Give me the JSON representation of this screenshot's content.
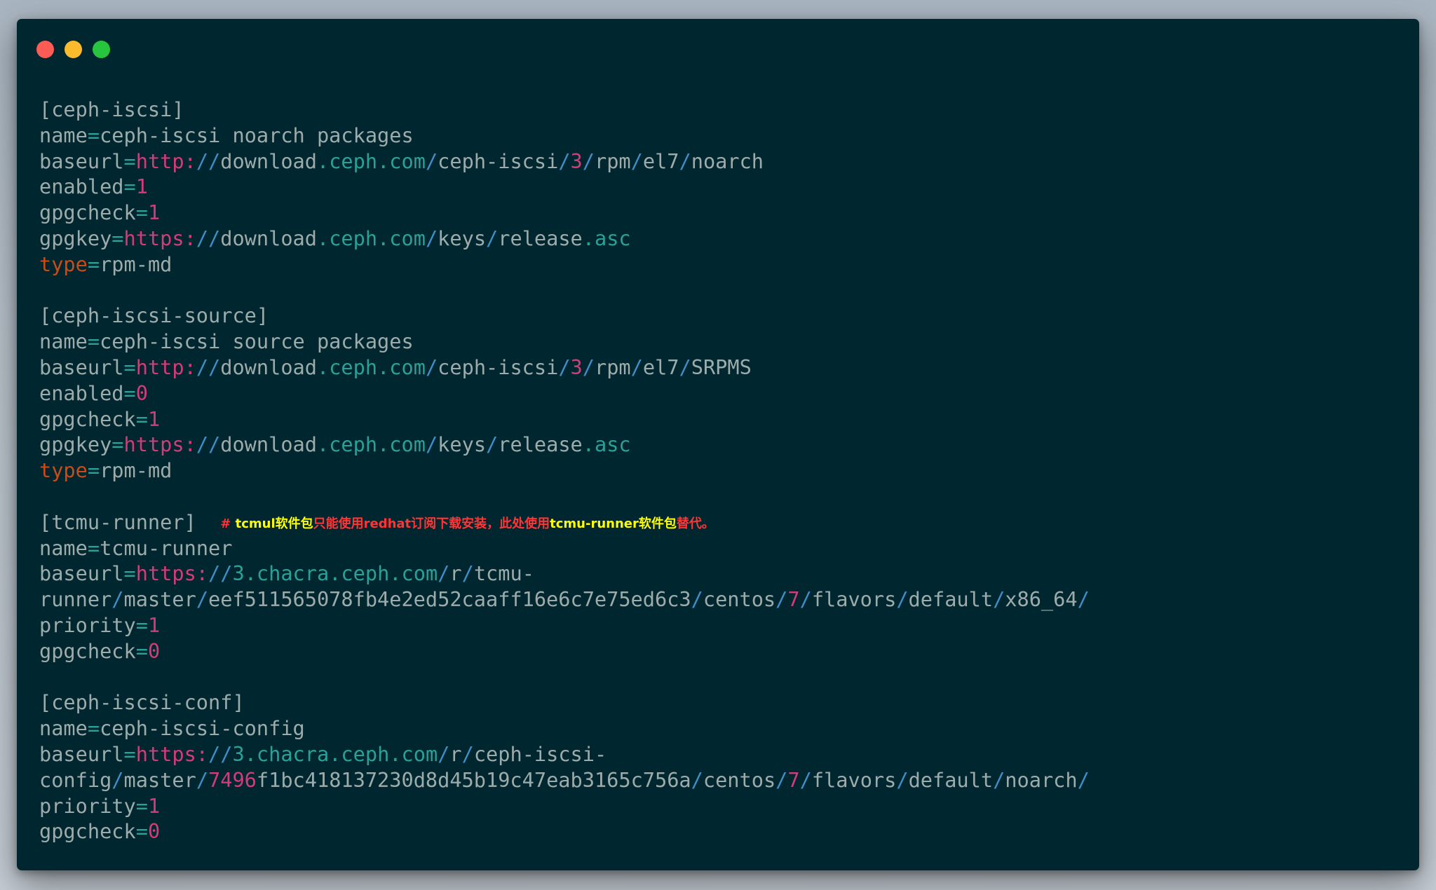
{
  "window": {
    "traffic_lights": [
      {
        "name": "close",
        "color": "#fd5c55"
      },
      {
        "name": "minimize",
        "color": "#fcbb2d"
      },
      {
        "name": "zoom",
        "color": "#28c63f"
      }
    ]
  },
  "theme": {
    "background": "#00272f",
    "text": "#9eabab",
    "pink": "#d33c79",
    "teal": "#2aa198",
    "blue": "#3f8ec7",
    "orange": "#cb4b16",
    "comment_red": "#ff3535",
    "comment_yellow": "#ffff00"
  },
  "code_lines": [
    [
      {
        "t": "[ceph-iscsi]"
      }
    ],
    [
      {
        "t": "name"
      },
      {
        "t": "=",
        "c": "teal"
      },
      {
        "t": "ceph-iscsi noarch packages"
      }
    ],
    [
      {
        "t": "baseurl"
      },
      {
        "t": "=",
        "c": "teal"
      },
      {
        "t": "http:",
        "c": "pink"
      },
      {
        "t": "//",
        "c": "blue"
      },
      {
        "t": "download"
      },
      {
        "t": ".",
        "c": "teal"
      },
      {
        "t": "ceph",
        "c": "teal"
      },
      {
        "t": ".",
        "c": "teal"
      },
      {
        "t": "com",
        "c": "teal"
      },
      {
        "t": "/",
        "c": "blue"
      },
      {
        "t": "ceph-iscsi"
      },
      {
        "t": "/",
        "c": "blue"
      },
      {
        "t": "3",
        "c": "pink"
      },
      {
        "t": "/",
        "c": "blue"
      },
      {
        "t": "rpm"
      },
      {
        "t": "/",
        "c": "blue"
      },
      {
        "t": "el7"
      },
      {
        "t": "/",
        "c": "blue"
      },
      {
        "t": "noarch"
      }
    ],
    [
      {
        "t": "enabled"
      },
      {
        "t": "=",
        "c": "teal"
      },
      {
        "t": "1",
        "c": "pink"
      }
    ],
    [
      {
        "t": "gpgcheck"
      },
      {
        "t": "=",
        "c": "teal"
      },
      {
        "t": "1",
        "c": "pink"
      }
    ],
    [
      {
        "t": "gpgkey"
      },
      {
        "t": "=",
        "c": "teal"
      },
      {
        "t": "https:",
        "c": "pink"
      },
      {
        "t": "//",
        "c": "blue"
      },
      {
        "t": "download"
      },
      {
        "t": ".",
        "c": "teal"
      },
      {
        "t": "ceph",
        "c": "teal"
      },
      {
        "t": ".",
        "c": "teal"
      },
      {
        "t": "com",
        "c": "teal"
      },
      {
        "t": "/",
        "c": "blue"
      },
      {
        "t": "keys"
      },
      {
        "t": "/",
        "c": "blue"
      },
      {
        "t": "release"
      },
      {
        "t": ".",
        "c": "teal"
      },
      {
        "t": "asc",
        "c": "teal"
      }
    ],
    [
      {
        "t": "type",
        "c": "orange"
      },
      {
        "t": "=",
        "c": "teal"
      },
      {
        "t": "rpm-md"
      }
    ],
    [],
    [
      {
        "t": "[ceph-iscsi-source]"
      }
    ],
    [
      {
        "t": "name"
      },
      {
        "t": "=",
        "c": "teal"
      },
      {
        "t": "ceph-iscsi source packages"
      }
    ],
    [
      {
        "t": "baseurl"
      },
      {
        "t": "=",
        "c": "teal"
      },
      {
        "t": "http:",
        "c": "pink"
      },
      {
        "t": "//",
        "c": "blue"
      },
      {
        "t": "download"
      },
      {
        "t": ".",
        "c": "teal"
      },
      {
        "t": "ceph",
        "c": "teal"
      },
      {
        "t": ".",
        "c": "teal"
      },
      {
        "t": "com",
        "c": "teal"
      },
      {
        "t": "/",
        "c": "blue"
      },
      {
        "t": "ceph-iscsi"
      },
      {
        "t": "/",
        "c": "blue"
      },
      {
        "t": "3",
        "c": "pink"
      },
      {
        "t": "/",
        "c": "blue"
      },
      {
        "t": "rpm"
      },
      {
        "t": "/",
        "c": "blue"
      },
      {
        "t": "el7"
      },
      {
        "t": "/",
        "c": "blue"
      },
      {
        "t": "SRPMS"
      }
    ],
    [
      {
        "t": "enabled"
      },
      {
        "t": "=",
        "c": "teal"
      },
      {
        "t": "0",
        "c": "pink"
      }
    ],
    [
      {
        "t": "gpgcheck"
      },
      {
        "t": "=",
        "c": "teal"
      },
      {
        "t": "1",
        "c": "pink"
      }
    ],
    [
      {
        "t": "gpgkey"
      },
      {
        "t": "=",
        "c": "teal"
      },
      {
        "t": "https:",
        "c": "pink"
      },
      {
        "t": "//",
        "c": "blue"
      },
      {
        "t": "download"
      },
      {
        "t": ".",
        "c": "teal"
      },
      {
        "t": "ceph",
        "c": "teal"
      },
      {
        "t": ".",
        "c": "teal"
      },
      {
        "t": "com",
        "c": "teal"
      },
      {
        "t": "/",
        "c": "blue"
      },
      {
        "t": "keys"
      },
      {
        "t": "/",
        "c": "blue"
      },
      {
        "t": "release"
      },
      {
        "t": ".",
        "c": "teal"
      },
      {
        "t": "asc",
        "c": "teal"
      }
    ],
    [
      {
        "t": "type",
        "c": "orange"
      },
      {
        "t": "=",
        "c": "teal"
      },
      {
        "t": "rpm-md"
      }
    ],
    [],
    [
      {
        "t": "[tcmu-runner]  "
      },
      {
        "t": "# ",
        "c": "comment_red",
        "k": "comment"
      },
      {
        "t": "tcmul软件包",
        "c": "comment_yellow",
        "k": "comment"
      },
      {
        "t": "只能使用redhat订阅下载安装，此处使用",
        "c": "comment_red",
        "k": "comment"
      },
      {
        "t": "tcmu-runner软件包",
        "c": "comment_yellow",
        "k": "comment"
      },
      {
        "t": "替代。",
        "c": "comment_red",
        "k": "comment"
      }
    ],
    [
      {
        "t": "name"
      },
      {
        "t": "=",
        "c": "teal"
      },
      {
        "t": "tcmu-runner"
      }
    ],
    [
      {
        "t": "baseurl"
      },
      {
        "t": "=",
        "c": "teal"
      },
      {
        "t": "https:",
        "c": "pink"
      },
      {
        "t": "//",
        "c": "blue"
      },
      {
        "t": "3",
        "c": "teal"
      },
      {
        "t": ".",
        "c": "teal"
      },
      {
        "t": "chacra",
        "c": "teal"
      },
      {
        "t": ".",
        "c": "teal"
      },
      {
        "t": "ceph",
        "c": "teal"
      },
      {
        "t": ".",
        "c": "teal"
      },
      {
        "t": "com",
        "c": "teal"
      },
      {
        "t": "/",
        "c": "blue"
      },
      {
        "t": "r"
      },
      {
        "t": "/",
        "c": "blue"
      },
      {
        "t": "tcmu-"
      }
    ],
    [
      {
        "t": "runner"
      },
      {
        "t": "/",
        "c": "blue"
      },
      {
        "t": "master"
      },
      {
        "t": "/",
        "c": "blue"
      },
      {
        "t": "eef511565078fb4e2ed52caaff16e6c7e75ed6c3"
      },
      {
        "t": "/",
        "c": "blue"
      },
      {
        "t": "centos"
      },
      {
        "t": "/",
        "c": "blue"
      },
      {
        "t": "7",
        "c": "pink"
      },
      {
        "t": "/",
        "c": "blue"
      },
      {
        "t": "flavors"
      },
      {
        "t": "/",
        "c": "blue"
      },
      {
        "t": "default"
      },
      {
        "t": "/",
        "c": "blue"
      },
      {
        "t": "x86_64"
      },
      {
        "t": "/",
        "c": "blue"
      }
    ],
    [
      {
        "t": "priority"
      },
      {
        "t": "=",
        "c": "teal"
      },
      {
        "t": "1",
        "c": "pink"
      }
    ],
    [
      {
        "t": "gpgcheck"
      },
      {
        "t": "=",
        "c": "teal"
      },
      {
        "t": "0",
        "c": "pink"
      }
    ],
    [],
    [
      {
        "t": "[ceph-iscsi-conf]"
      }
    ],
    [
      {
        "t": "name"
      },
      {
        "t": "=",
        "c": "teal"
      },
      {
        "t": "ceph-iscsi-config"
      }
    ],
    [
      {
        "t": "baseurl"
      },
      {
        "t": "=",
        "c": "teal"
      },
      {
        "t": "https:",
        "c": "pink"
      },
      {
        "t": "//",
        "c": "blue"
      },
      {
        "t": "3",
        "c": "teal"
      },
      {
        "t": ".",
        "c": "teal"
      },
      {
        "t": "chacra",
        "c": "teal"
      },
      {
        "t": ".",
        "c": "teal"
      },
      {
        "t": "ceph",
        "c": "teal"
      },
      {
        "t": ".",
        "c": "teal"
      },
      {
        "t": "com",
        "c": "teal"
      },
      {
        "t": "/",
        "c": "blue"
      },
      {
        "t": "r"
      },
      {
        "t": "/",
        "c": "blue"
      },
      {
        "t": "ceph-iscsi-"
      }
    ],
    [
      {
        "t": "config"
      },
      {
        "t": "/",
        "c": "blue"
      },
      {
        "t": "master"
      },
      {
        "t": "/",
        "c": "blue"
      },
      {
        "t": "7496",
        "c": "pink"
      },
      {
        "t": "f1bc418137230d8d45b19c47eab3165c756a"
      },
      {
        "t": "/",
        "c": "blue"
      },
      {
        "t": "centos"
      },
      {
        "t": "/",
        "c": "blue"
      },
      {
        "t": "7",
        "c": "pink"
      },
      {
        "t": "/",
        "c": "blue"
      },
      {
        "t": "flavors"
      },
      {
        "t": "/",
        "c": "blue"
      },
      {
        "t": "default"
      },
      {
        "t": "/",
        "c": "blue"
      },
      {
        "t": "noarch"
      },
      {
        "t": "/",
        "c": "blue"
      }
    ],
    [
      {
        "t": "priority"
      },
      {
        "t": "=",
        "c": "teal"
      },
      {
        "t": "1",
        "c": "pink"
      }
    ],
    [
      {
        "t": "gpgcheck"
      },
      {
        "t": "=",
        "c": "teal"
      },
      {
        "t": "0",
        "c": "pink"
      }
    ]
  ]
}
